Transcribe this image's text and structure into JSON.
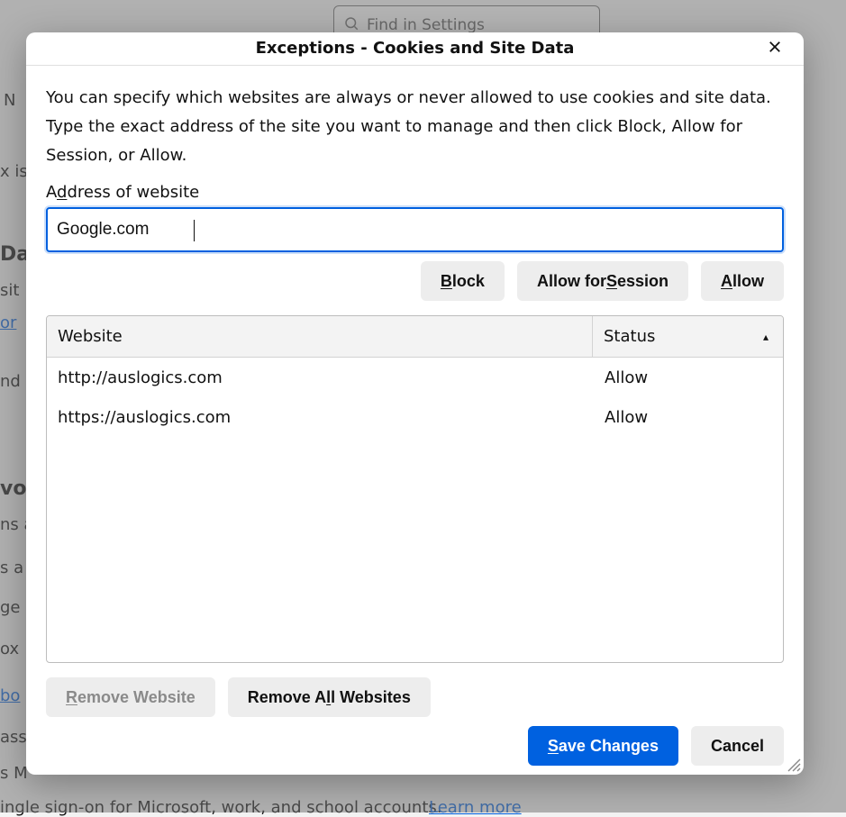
{
  "background": {
    "search_placeholder": "Find in Settings",
    "frags": {
      "n": "N",
      "x_is": "x is",
      "da": "Da",
      "sit": " sit",
      "learn_more": "or",
      "nd": "nd",
      "vor": "vor",
      "ns_a": "ns a",
      "s_a": "s a",
      "ger": "ge",
      "ox": "ox",
      "bo": "bo",
      "assv": "assv",
      "s_m": "s M",
      "sso": "ingle sign-on for Microsoft, work, and school accounts.",
      "learn": "Learn more"
    }
  },
  "dialog": {
    "title": "Exceptions - Cookies and Site Data",
    "description": "You can specify which websites are always or never allowed to use cookies and site data. Type the exact address of the site you want to manage and then click Block, Allow for Session, or Allow.",
    "address_label_pre": "A",
    "address_label_u": "d",
    "address_label_post": "dress of website",
    "address_value": "Google.com",
    "buttons": {
      "block_pre": "",
      "block_u": "B",
      "block_post": "lock",
      "afs_pre": "Allow for ",
      "afs_u": "S",
      "afs_post": "ession",
      "allow_pre": "",
      "allow_u": "A",
      "allow_post": "llow"
    },
    "table": {
      "website_header": "Website",
      "status_header": "Status",
      "sort_glyph": "▴",
      "rows": [
        {
          "website": "http://auslogics.com",
          "status": "Allow"
        },
        {
          "website": "https://auslogics.com",
          "status": "Allow"
        }
      ]
    },
    "lower_buttons": {
      "remove_pre": "",
      "remove_u": "R",
      "remove_post": "emove Website",
      "remove_all_pre": "Remove A",
      "remove_all_u": "l",
      "remove_all_post": "l Websites"
    },
    "footer_buttons": {
      "save_pre": "",
      "save_u": "S",
      "save_post": "ave Changes",
      "cancel": "Cancel"
    }
  }
}
